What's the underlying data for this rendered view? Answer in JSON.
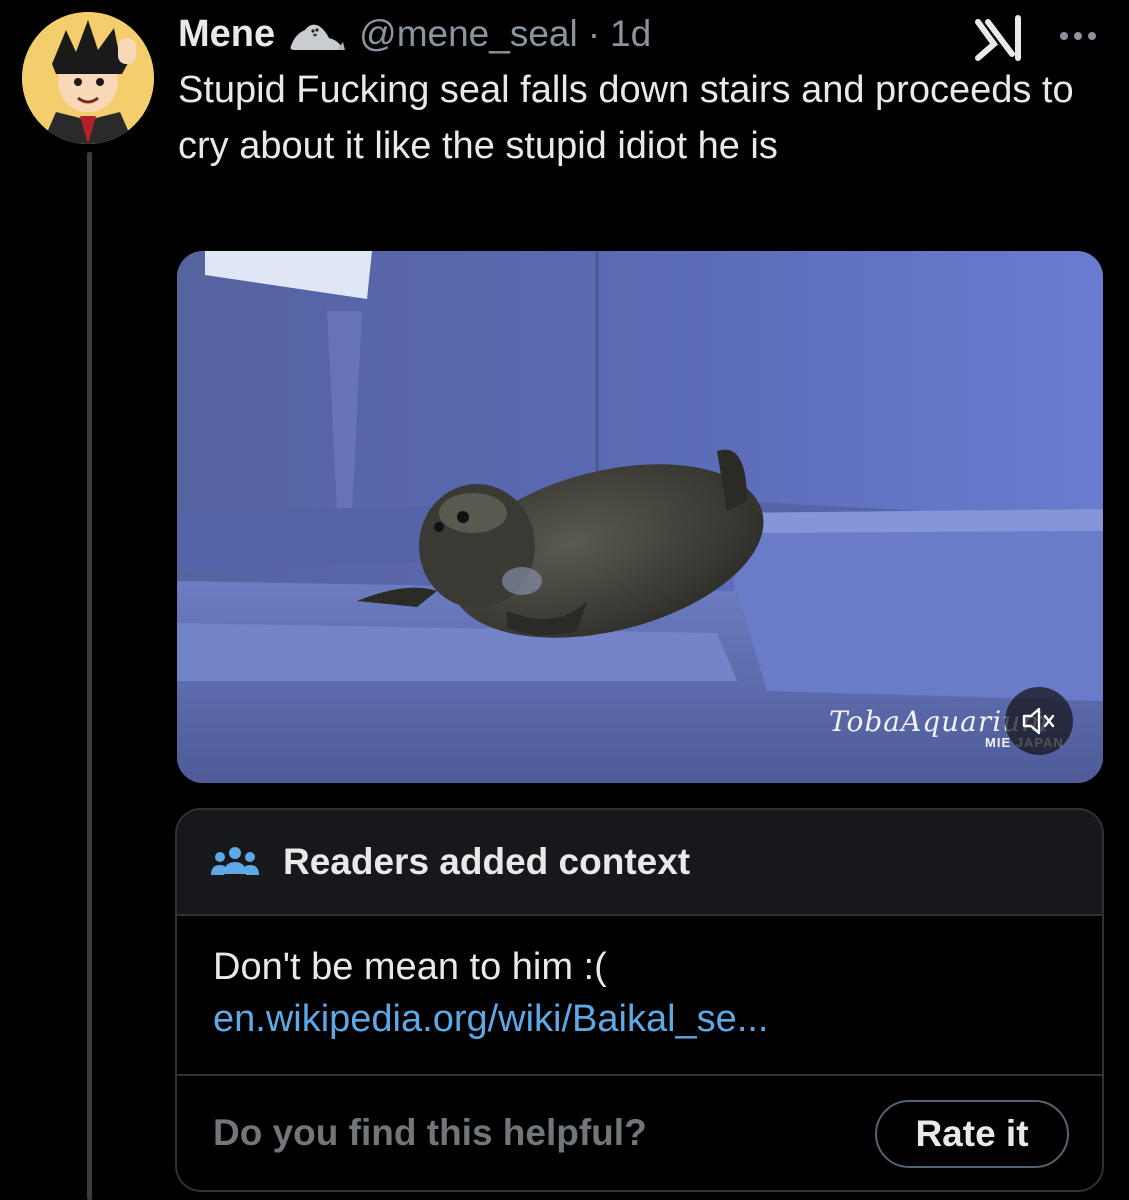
{
  "tweet": {
    "author": {
      "display_name": "Mene",
      "name_emoji": "seal",
      "handle": "@mene_seal",
      "time_separator": "·",
      "time": "1d"
    },
    "text": "Stupid Fucking seal falls down stairs and proceeds to cry about it like the stupid idiot he is",
    "media": {
      "watermark_main": "TobaAquarium",
      "watermark_sub": "MIE JAPAN",
      "muted": true
    }
  },
  "community_note": {
    "title": "Readers added context",
    "text": "Don't be mean to him :(",
    "link": "en.wikipedia.org/wiki/Baikal_se...",
    "question": "Do you find this helpful?",
    "rate_label": "Rate it"
  },
  "icons": {
    "avatar": "anime-avatar",
    "emoji": "seal-emoji-icon",
    "grok": "grok-icon",
    "more": "more-options-icon",
    "mute": "mute-icon",
    "community": "people-icon"
  },
  "colors": {
    "background": "#000000",
    "text_primary": "#e7e9ea",
    "text_secondary": "#8b949c",
    "link": "#5ea8e6",
    "border": "#2f3336",
    "note_header_bg": "#16181c"
  }
}
